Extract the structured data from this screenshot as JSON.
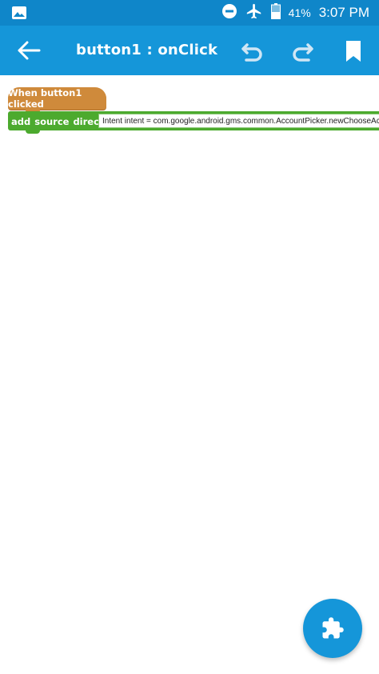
{
  "status_bar": {
    "battery_percent": "41%",
    "time": "3:07 PM",
    "icons": [
      "image-icon",
      "do-not-disturb-icon",
      "airplane-mode-icon",
      "battery-icon"
    ]
  },
  "app_bar": {
    "title": "button1 : onClick",
    "icons": [
      "back-arrow-icon",
      "undo-icon",
      "redo-icon",
      "bookmark-icon"
    ]
  },
  "blocks": {
    "event_label": "When button1 clicked",
    "statement_label": "add source directly",
    "statement_value": "Intent intent = com.google.android.gms.common.AccountPicker.newChooseAc"
  },
  "fab": {
    "icon": "puzzle-piece-icon"
  },
  "colors": {
    "status_bar": "#0f86c9",
    "app_bar": "#1596d9",
    "event_block": "#cf8a3b",
    "statement_block": "#4caa2e",
    "fab": "#1596d9"
  }
}
